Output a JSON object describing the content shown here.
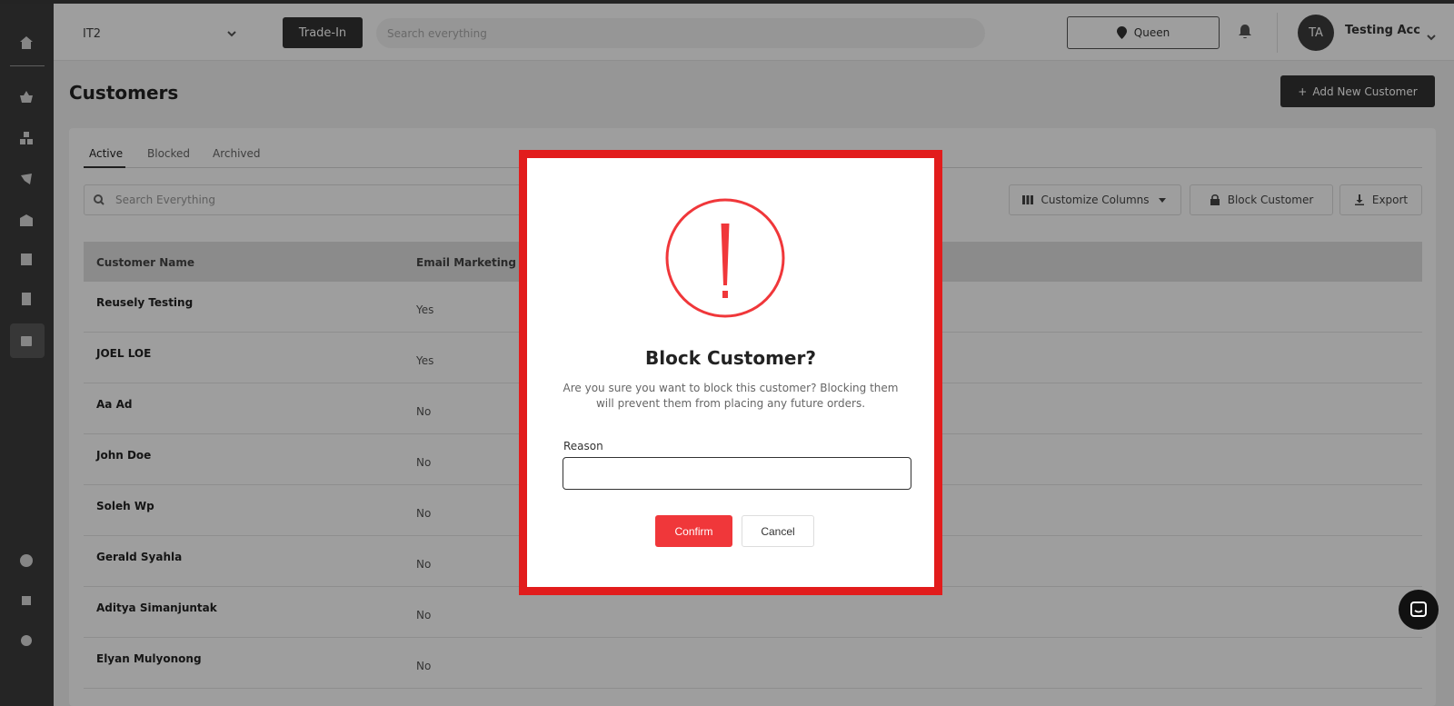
{
  "header": {
    "store": "IT2",
    "trade_in_label": "Trade-In",
    "search_placeholder": "Search everything",
    "location": "Queen",
    "avatar_initials": "TA",
    "user_name": "Testing Acc"
  },
  "sidebar": {
    "icons": [
      "home-icon",
      "basket-icon",
      "inventory-icon",
      "marketing-icon",
      "warehouse-icon",
      "store-icon",
      "orders-icon",
      "customers-icon",
      "help-icon",
      "integrations-icon",
      "settings-icon"
    ],
    "active": "customers-icon"
  },
  "page": {
    "title": "Customers",
    "add_button": "Add New Customer"
  },
  "tabs": [
    {
      "label": "Active",
      "active": true
    },
    {
      "label": "Blocked",
      "active": false
    },
    {
      "label": "Archived",
      "active": false
    }
  ],
  "toolbar": {
    "search_placeholder": "Search Everything",
    "customize_columns": "Customize Columns",
    "block_customer": "Block Customer",
    "export": "Export"
  },
  "table": {
    "columns": [
      "Customer Name",
      "Email Marketing O"
    ],
    "rows": [
      {
        "name": "Reusely Testing",
        "email_marketing": "Yes"
      },
      {
        "name": "JOEL LOE",
        "email_marketing": "Yes"
      },
      {
        "name": "Aa Ad",
        "email_marketing": "No"
      },
      {
        "name": "John Doe",
        "email_marketing": "No"
      },
      {
        "name": "Soleh Wp",
        "email_marketing": "No"
      },
      {
        "name": "Gerald Syahla",
        "email_marketing": "No"
      },
      {
        "name": "Aditya Simanjuntak",
        "email_marketing": "No"
      },
      {
        "name": "Elyan Mulyonong",
        "email_marketing": "No"
      }
    ]
  },
  "modal": {
    "title": "Block Customer?",
    "message": "Are you sure you want to block this customer? Blocking them will prevent them from placing any future orders.",
    "reason_label": "Reason",
    "reason_value": "",
    "confirm_label": "Confirm",
    "cancel_label": "Cancel"
  },
  "colors": {
    "highlight_border": "#e21c1c",
    "warning": "#f0373a",
    "dark": "#333333"
  }
}
